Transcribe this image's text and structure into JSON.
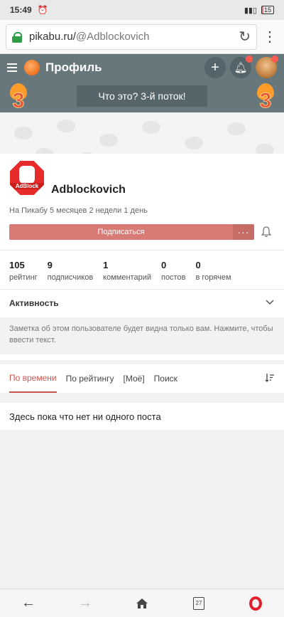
{
  "status_bar": {
    "time": "15:49",
    "battery": "15",
    "battery_level": 0.15
  },
  "browser": {
    "url_domain": "pikabu.ru/",
    "url_path": "@Adblockovich"
  },
  "header": {
    "title": "Профиль",
    "banner_text": "Что это? 3-й поток!",
    "flame_number": "3"
  },
  "profile": {
    "username": "Adblockovich",
    "badge_text": "AdBlock",
    "since": "На Пикабу 5 месяцев 2 недели 1 день",
    "subscribe_label": "Подписаться",
    "more_label": "···",
    "stats": [
      {
        "value": "105",
        "label": "рейтинг"
      },
      {
        "value": "9",
        "label": "подписчиков"
      },
      {
        "value": "1",
        "label": "комментарий"
      },
      {
        "value": "0",
        "label": "постов"
      },
      {
        "value": "0",
        "label": "в горячем"
      }
    ],
    "activity_label": "Активность",
    "note_text": "Заметка об этом пользователе будет видна только вам. Нажмите, чтобы ввести текст."
  },
  "tabs": [
    {
      "label": "По времени",
      "active": true
    },
    {
      "label": "По рейтингу",
      "active": false
    },
    {
      "label": "[Моё]",
      "active": false
    },
    {
      "label": "Поиск",
      "active": false
    }
  ],
  "empty_message": "Здесь пока что нет ни одного поста",
  "bottom_nav": {
    "tabs_count": "27"
  },
  "colors": {
    "header_bg": "#67777c",
    "accent": "#c9574f",
    "subscribe": "#d87b74"
  }
}
